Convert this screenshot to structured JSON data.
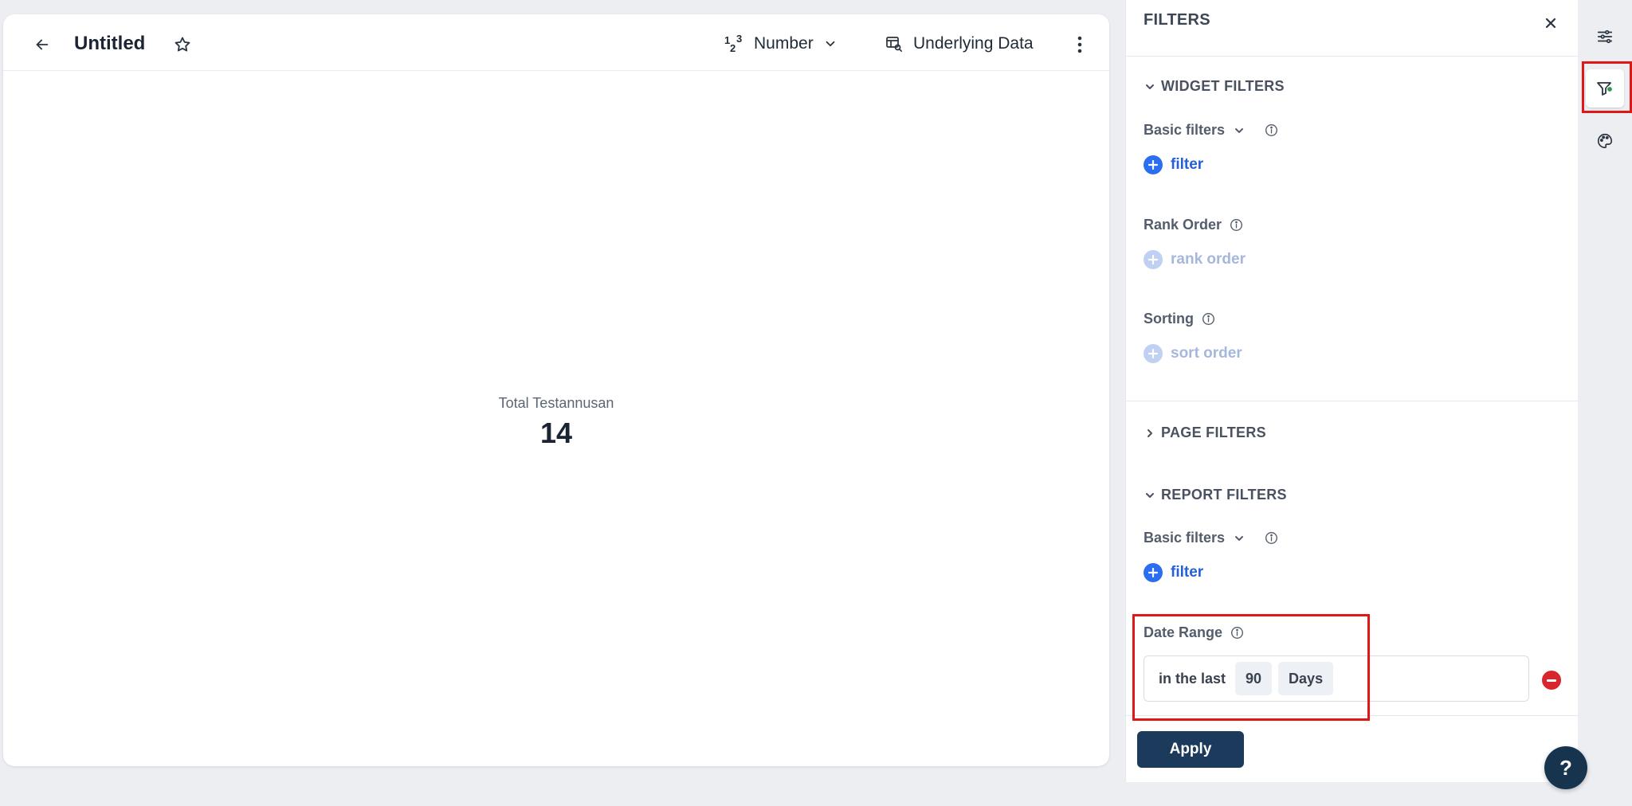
{
  "widget": {
    "title": "Untitled",
    "viz_type_label": "Number",
    "viz_icon_digits": {
      "a": "1",
      "b": "2",
      "c": "3"
    },
    "underlying_data_label": "Underlying Data",
    "metric": {
      "label": "Total Testannusan",
      "value": "14"
    }
  },
  "filters_panel": {
    "title": "FILTERS",
    "widget_filters": {
      "heading": "WIDGET FILTERS",
      "basic_filters": {
        "label": "Basic filters",
        "add_label": "filter"
      },
      "rank_order": {
        "label": "Rank Order",
        "add_label": "rank order"
      },
      "sorting": {
        "label": "Sorting",
        "add_label": "sort order"
      }
    },
    "page_filters": {
      "heading": "PAGE FILTERS"
    },
    "report_filters": {
      "heading": "REPORT FILTERS",
      "basic_filters": {
        "label": "Basic filters",
        "add_label": "filter"
      },
      "date_range": {
        "label": "Date Range",
        "operator": "in the last",
        "amount": "90",
        "unit": "Days"
      }
    },
    "apply_label": "Apply"
  },
  "help_label": "?",
  "colors": {
    "accent_blue": "#2b6ef2",
    "apply_button": "#1b3a5c",
    "remove_red": "#d9252c",
    "highlight_red": "#e01717"
  },
  "icons": {
    "header": [
      "arrow-left-icon",
      "star-icon",
      "number-icon",
      "chevron-down-icon",
      "table-search-icon",
      "kebab-icon"
    ],
    "rail": [
      "sliders-icon",
      "filter-icon",
      "palette-icon"
    ]
  }
}
